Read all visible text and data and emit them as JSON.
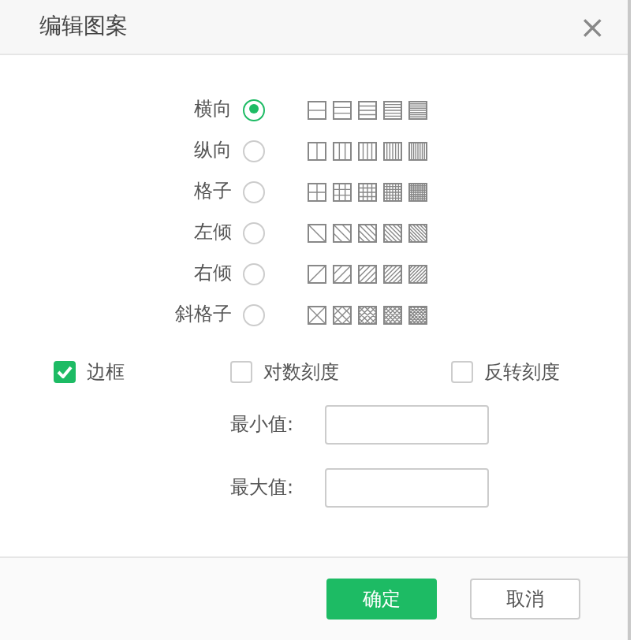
{
  "window": {
    "title": "编辑图案",
    "close": "×"
  },
  "patterns": [
    {
      "label": "横向",
      "kind": "horizontal",
      "selected": true
    },
    {
      "label": "纵向",
      "kind": "vertical",
      "selected": false
    },
    {
      "label": "格子",
      "kind": "grid",
      "selected": false
    },
    {
      "label": "左倾",
      "kind": "left",
      "selected": false
    },
    {
      "label": "右倾",
      "kind": "right",
      "selected": false
    },
    {
      "label": "斜格子",
      "kind": "cross",
      "selected": false
    }
  ],
  "options": [
    {
      "label": "边框",
      "checked": true
    },
    {
      "label": "对数刻度",
      "checked": false
    },
    {
      "label": "反转刻度",
      "checked": false
    }
  ],
  "fields": [
    {
      "label": "最小值:"
    },
    {
      "label": "最大值:"
    }
  ],
  "buttons": [
    {
      "label": "确定",
      "kind": "primary"
    },
    {
      "label": "取消",
      "kind": "secondary"
    }
  ]
}
